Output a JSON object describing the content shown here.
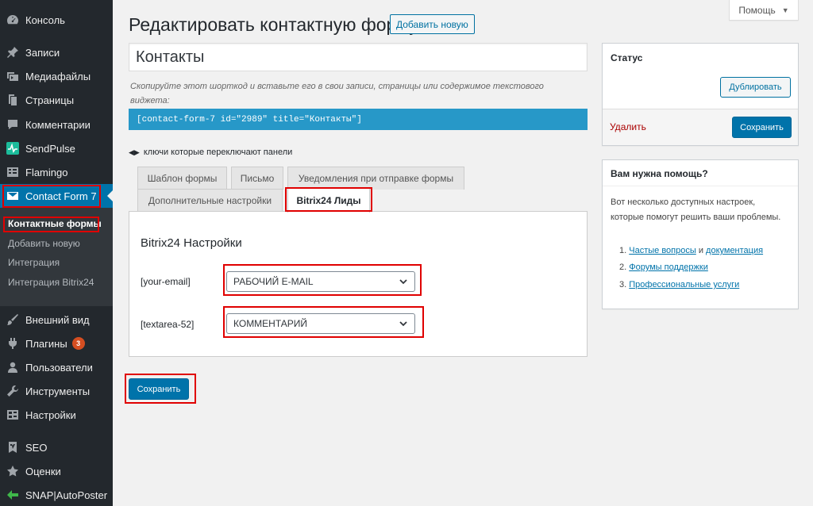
{
  "sidebar": {
    "items": [
      {
        "label": "Консоль",
        "icon": "dashboard-icon"
      },
      {
        "label": "Записи",
        "icon": "pin-icon"
      },
      {
        "label": "Медиафайлы",
        "icon": "media-icon"
      },
      {
        "label": "Страницы",
        "icon": "pages-icon"
      },
      {
        "label": "Комментарии",
        "icon": "comments-icon"
      },
      {
        "label": "SendPulse",
        "icon": "sendpulse-icon"
      },
      {
        "label": "Flamingo",
        "icon": "flamingo-icon"
      },
      {
        "label": "Contact Form 7",
        "icon": "mail-icon"
      },
      {
        "label": "Внешний вид",
        "icon": "brush-icon"
      },
      {
        "label": "Плагины",
        "icon": "plugin-icon",
        "badge": "3"
      },
      {
        "label": "Пользователи",
        "icon": "users-icon"
      },
      {
        "label": "Инструменты",
        "icon": "wrench-icon"
      },
      {
        "label": "Настройки",
        "icon": "settings-icon"
      },
      {
        "label": "SEO",
        "icon": "seo-icon"
      },
      {
        "label": "Оценки",
        "icon": "star-icon"
      },
      {
        "label": "SNAP|AutoPoster",
        "icon": "snap-icon"
      }
    ],
    "submenu": [
      {
        "label": "Контактные формы"
      },
      {
        "label": "Добавить новую"
      },
      {
        "label": "Интеграция"
      },
      {
        "label": "Интеграция Bitrix24"
      }
    ]
  },
  "header": {
    "help_label": "Помощь",
    "title": "Редактировать контактную форму",
    "add_new_label": "Добавить новую"
  },
  "form": {
    "title_value": "Контакты",
    "shortcode_description": "Скопируйте этот шорткод и вставьте его в свои записи, страницы или содержимое текстового виджета:",
    "shortcode": "[contact-form-7 id=\"2989\" title=\"Контакты\"]",
    "panel_toggle_label": "ключи которые переключают панели",
    "tabs": [
      {
        "label": "Шаблон формы"
      },
      {
        "label": "Письмо"
      },
      {
        "label": "Уведомления при отправке формы"
      },
      {
        "label": "Дополнительные настройки"
      },
      {
        "label": "Bitrix24 Лиды"
      }
    ],
    "panel_heading": "Bitrix24 Настройки",
    "fields": [
      {
        "label": "[your-email]",
        "value": "РАБОЧИЙ E-MAIL"
      },
      {
        "label": "[textarea-52]",
        "value": "КОММЕНТАРИЙ"
      }
    ],
    "save_label": "Сохранить"
  },
  "status_box": {
    "title": "Статус",
    "duplicate_label": "Дублировать",
    "delete_label": "Удалить",
    "save_label": "Сохранить"
  },
  "help_box": {
    "title": "Вам нужна помощь?",
    "text": "Вот несколько доступных настроек, которые помогут решить ваши проблемы.",
    "items": [
      {
        "num": "1.",
        "link1": "Частые вопросы",
        "joiner": " и ",
        "link2": "документация"
      },
      {
        "num": "2.",
        "link1": "Форумы поддержки"
      },
      {
        "num": "3.",
        "link1": "Профессиональные услуги"
      }
    ]
  },
  "colors": {
    "sidebar_bg": "#23282d",
    "accent": "#0073aa",
    "shortcode_bg": "#2798c8",
    "highlight": "#e00000"
  }
}
